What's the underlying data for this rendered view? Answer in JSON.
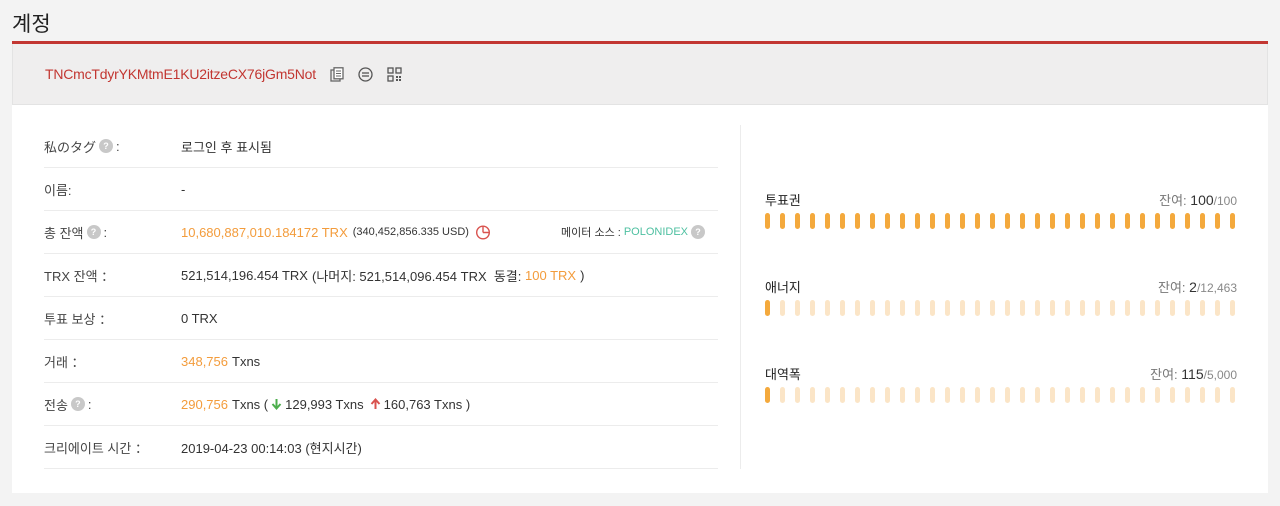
{
  "page": {
    "title": "계정"
  },
  "account": {
    "address": "TNCmcTdyrYKMtmE1KU2itzeCX76jGm5Not"
  },
  "rows": {
    "tag": {
      "label": "私のタグ",
      "suffix": ":",
      "value": "로그인 후 표시됨"
    },
    "name": {
      "label": "이름:",
      "value": "-"
    },
    "total": {
      "label": "총 잔액",
      "suffix": ":",
      "value": "10,680,887,010.184172 TRX",
      "usd": "(340,452,856.335 USD)",
      "source_label": "메이터 소스 :",
      "source_value": "POLONIDEX"
    },
    "trx": {
      "label": "TRX 잔액 ：",
      "value": "521,514,196.454 TRX",
      "rest": "(나머지: 521,514,096.454 TRX  동결: ",
      "frozen": "100 TRX",
      "close": ")"
    },
    "vote": {
      "label": "투표 보상 ：",
      "value": "0 TRX"
    },
    "tx": {
      "label": "거래 ：",
      "count": "348,756",
      "unit": "Txns"
    },
    "transfer": {
      "label": "전송",
      "suffix": ":",
      "count": "290,756",
      "unit": "Txns (",
      "in": "129,993 Txns",
      "out": "160,763 Txns )"
    },
    "created": {
      "label": "크리에이트 시간 ：",
      "value": "2019-04-23 00:14:03 (현지시간)"
    }
  },
  "resources": [
    {
      "name": "투표권",
      "remain_label": "잔여:",
      "remain": "100",
      "total": "/100",
      "fraction": 1.0
    },
    {
      "name": "애너지",
      "remain_label": "잔여:",
      "remain": "2",
      "total": "/12,463",
      "fraction": 0.0002
    },
    {
      "name": "대역폭",
      "remain_label": "잔여:",
      "remain": "115",
      "total": "/5,000",
      "fraction": 0.023
    }
  ],
  "colors": {
    "accent_red": "#c23631",
    "orange": "#f39c3c",
    "bar_on": "#f4a93c",
    "bar_off": "#fbe5c7",
    "green": "#4fc0a1"
  },
  "icons": [
    "copy-icon",
    "transfer-icon",
    "qr-code-icon",
    "pie-chart-icon",
    "arrow-down-icon",
    "arrow-up-icon",
    "help-icon"
  ]
}
